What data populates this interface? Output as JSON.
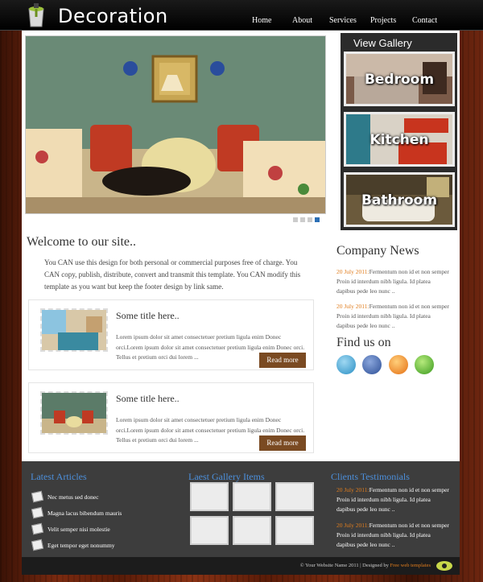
{
  "header": {
    "logo_text": "Decoration",
    "nav": [
      "Home",
      "About",
      "Services",
      "Projects",
      "Contact"
    ]
  },
  "gallery": {
    "title": "View Gallery",
    "items": [
      "Bedroom",
      "Kitchen",
      "Bathroom"
    ]
  },
  "welcome": {
    "title": "Welcome to our site..",
    "text": "You CAN use this design for both personal or commercial purposes free of charge. You CAN copy, publish, distribute, convert and transmit this template. You CAN modify this template as you want but keep the footer design by link same."
  },
  "posts": [
    {
      "title": "Some title here..",
      "text": "Lorem ipsum dolor sit amet consectetuer pretium ligula enim Donec orci.Lorem ipsum dolor sit amet consectetuer pretium ligula enim Donec orci. Tellus et pretium orci dui lorem ...",
      "button": "Read more"
    },
    {
      "title": "Some title here..",
      "text": "Lorem ipsum dolor sit amet consectetuer pretium ligula enim Donec orci.Lorem ipsum dolor sit amet consectetuer pretium ligula enim Donec orci. Tellus et pretium orci dui lorem ...",
      "button": "Read more"
    }
  ],
  "company_news": {
    "title": "Company News",
    "items": [
      {
        "date": "20 July 2011:",
        "text": "Fermentum non id et non semper Proin id interdum nibh ligula. Id platea dapibus pede leo nunc .."
      },
      {
        "date": "20 July 2011:",
        "text": "Fermentum non id et non semper Proin id interdum nibh ligula. Id platea dapibus pede leo nunc .."
      }
    ]
  },
  "find_us": {
    "title": "Find us on",
    "icons": [
      "twitter-icon",
      "facebook-icon",
      "rss-icon",
      "delicious-icon"
    ]
  },
  "footer": {
    "articles_title": "Latest Articles",
    "articles": [
      "Nec metus sed donec",
      "Magna lacus bibendum mauris",
      "Velit semper nisi molestie",
      "Eget tempor eget nonummy"
    ],
    "gallery_title": "Laest Gallery Items",
    "testimonials_title": "Clients Testimonials",
    "testimonials": [
      {
        "date": "20 July 2011:",
        "text": "Fermentum non id et non semper Proin id interdum nibh ligula. Id platea dapibus pede leo nunc .."
      },
      {
        "date": "20 July 2011:",
        "text": "Fermentum non id et non semper Proin id interdum nibh ligula. Id platea dapibus pede leo nunc .."
      }
    ]
  },
  "copyright": {
    "text": "© Your Website Name 2011 | Designed by ",
    "link": "Free web templates"
  },
  "colors": {
    "accent_link": "#4c8fdb",
    "date_orange": "#e07d1e",
    "button_brown": "#7a4a22"
  }
}
